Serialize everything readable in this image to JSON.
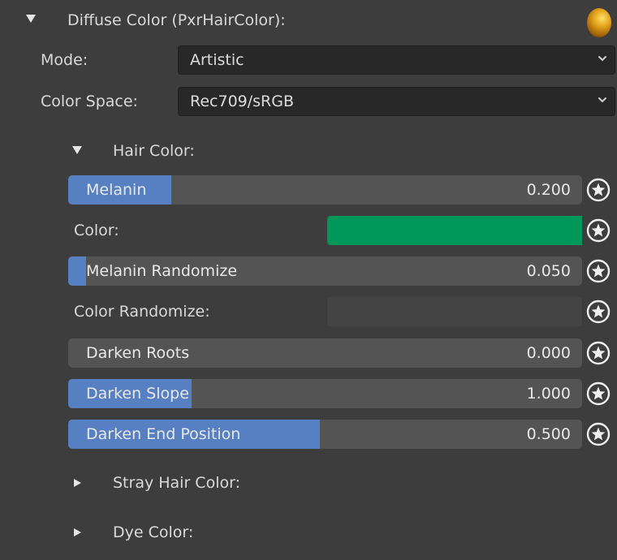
{
  "header": {
    "title": "Diffuse Color (PxrHairColor):",
    "material_icon": "sphere-preview-icon"
  },
  "mode": {
    "label": "Mode:",
    "value": "Artistic"
  },
  "color_space": {
    "label": "Color Space:",
    "value": "Rec709/sRGB"
  },
  "hair_color": {
    "title": "Hair Color:",
    "melanin": {
      "label": "Melanin",
      "value": "0.200",
      "fraction": 0.2
    },
    "color": {
      "label": "Color:",
      "hex": "#00985a"
    },
    "melanin_randomize": {
      "label": "Melanin Randomize",
      "value": "0.050",
      "fraction": 0.035
    },
    "color_randomize": {
      "label": "Color Randomize:"
    },
    "darken_roots": {
      "label": "Darken Roots",
      "value": "0.000",
      "fraction": 0.0
    },
    "darken_slope": {
      "label": "Darken Slope",
      "value": "1.000",
      "fraction": 0.24
    },
    "darken_end_position": {
      "label": "Darken End Position",
      "value": "0.500",
      "fraction": 0.49
    }
  },
  "stray_hair_color": {
    "title": "Stray Hair Color:"
  },
  "dye_color": {
    "title": "Dye Color:"
  },
  "colors": {
    "panel_bg": "#3d3d3d",
    "slider_bg": "#545454",
    "slider_fill": "#5680c2",
    "dropdown_bg": "#282828"
  },
  "icons": {
    "link": "star-link-icon",
    "chevron": "chevron-down-icon",
    "expand": "triangle-down-icon",
    "collapse": "triangle-right-icon"
  }
}
